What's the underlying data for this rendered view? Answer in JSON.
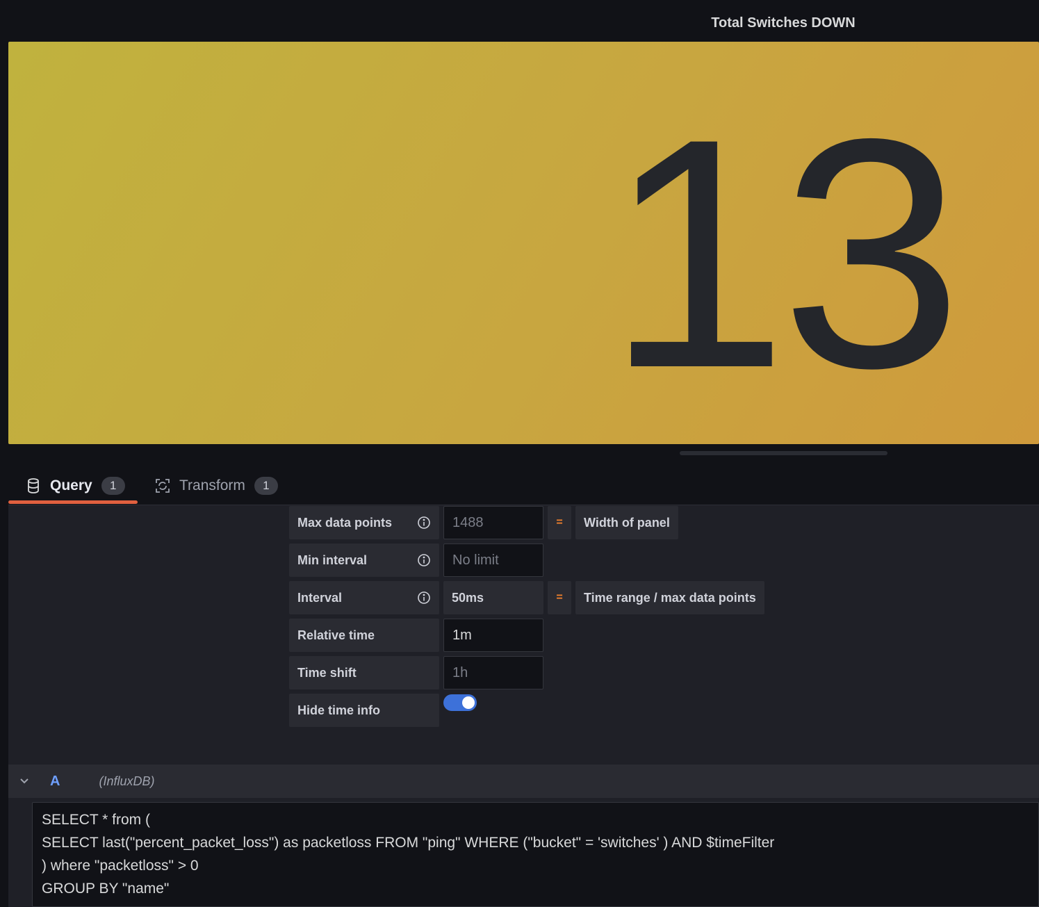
{
  "panel": {
    "title": "Total Switches DOWN",
    "value": "13",
    "background_colors": [
      "#c0b23e",
      "#cf9a3c"
    ]
  },
  "tabs": [
    {
      "label": "Query",
      "count": "1",
      "icon": "database-icon",
      "active": true
    },
    {
      "label": "Transform",
      "count": "1",
      "icon": "transform-icon",
      "active": false
    }
  ],
  "options": {
    "max_data_points": {
      "label": "Max data points",
      "placeholder": "1488",
      "eq": "=",
      "note": "Width of panel"
    },
    "min_interval": {
      "label": "Min interval",
      "placeholder": "No limit"
    },
    "interval": {
      "label": "Interval",
      "value": "50ms",
      "eq": "=",
      "note": "Time range / max data points"
    },
    "relative_time": {
      "label": "Relative time",
      "value": "1m"
    },
    "time_shift": {
      "label": "Time shift",
      "placeholder": "1h"
    },
    "hide_time_info": {
      "label": "Hide time info",
      "enabled": true
    }
  },
  "query": {
    "ref_id": "A",
    "datasource": "(InfluxDB)",
    "lines": [
      "SELECT * from (",
      "SELECT last(\"percent_packet_loss\") as packetloss FROM \"ping\" WHERE (\"bucket\" = 'switches' ) AND $timeFilter",
      ") where \"packetloss\" > 0",
      "GROUP BY \"name\""
    ]
  },
  "colors": {
    "accent_blue": "#3d71d9",
    "tab_underline": "#e0603f",
    "eq_orange": "#f5832c"
  }
}
